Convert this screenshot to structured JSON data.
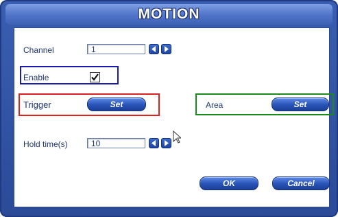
{
  "dialog": {
    "title": "MOTION"
  },
  "channel": {
    "label": "Channel",
    "value": "1",
    "prev_icon": "arrow-left-icon",
    "next_icon": "arrow-right-icon"
  },
  "enable": {
    "label": "Enable",
    "checked": true
  },
  "trigger": {
    "label": "Trigger",
    "button_label": "Set"
  },
  "area": {
    "label": "Area",
    "button_label": "Set"
  },
  "hold_time": {
    "label": "Hold time(s)",
    "value": "10",
    "prev_icon": "arrow-left-icon",
    "next_icon": "arrow-right-icon"
  },
  "footer": {
    "ok_label": "OK",
    "cancel_label": "Cancel"
  },
  "highlight_colors": {
    "enable": "#1a1ab0",
    "trigger": "#e02020",
    "area": "#1a8a1a"
  }
}
